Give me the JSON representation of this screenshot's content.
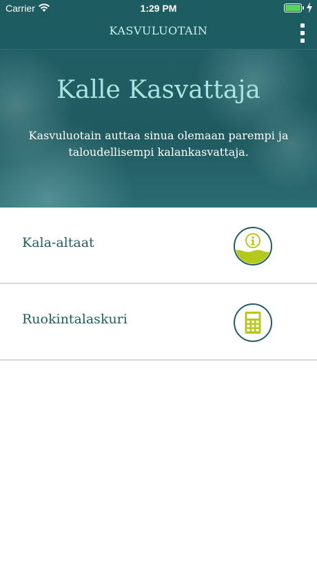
{
  "status_bar": {
    "carrier": "Carrier",
    "time": "1:29 PM",
    "icons": [
      "wifi-icon",
      "battery-icon",
      "charging-bolt-icon"
    ]
  },
  "nav": {
    "title": "KASVULUOTAIN",
    "menu_icon": "more-vertical-icon"
  },
  "hero": {
    "title": "Kalle Kasvattaja",
    "description": "Kasvuluotain auttaa sinua olemaan parempi ja taloudellisempi kalankasvattaja."
  },
  "menu": {
    "items": [
      {
        "label": "Kala-altaat",
        "icon": "info-water-icon"
      },
      {
        "label": "Ruokintalaskuri",
        "icon": "calculator-icon"
      }
    ]
  },
  "colors": {
    "header_bg": "#1d5d62",
    "title_accent": "#a9e4e1",
    "icon_green": "#b5c91a",
    "text_dark": "#1d5d62",
    "battery_green": "#58d45a"
  }
}
